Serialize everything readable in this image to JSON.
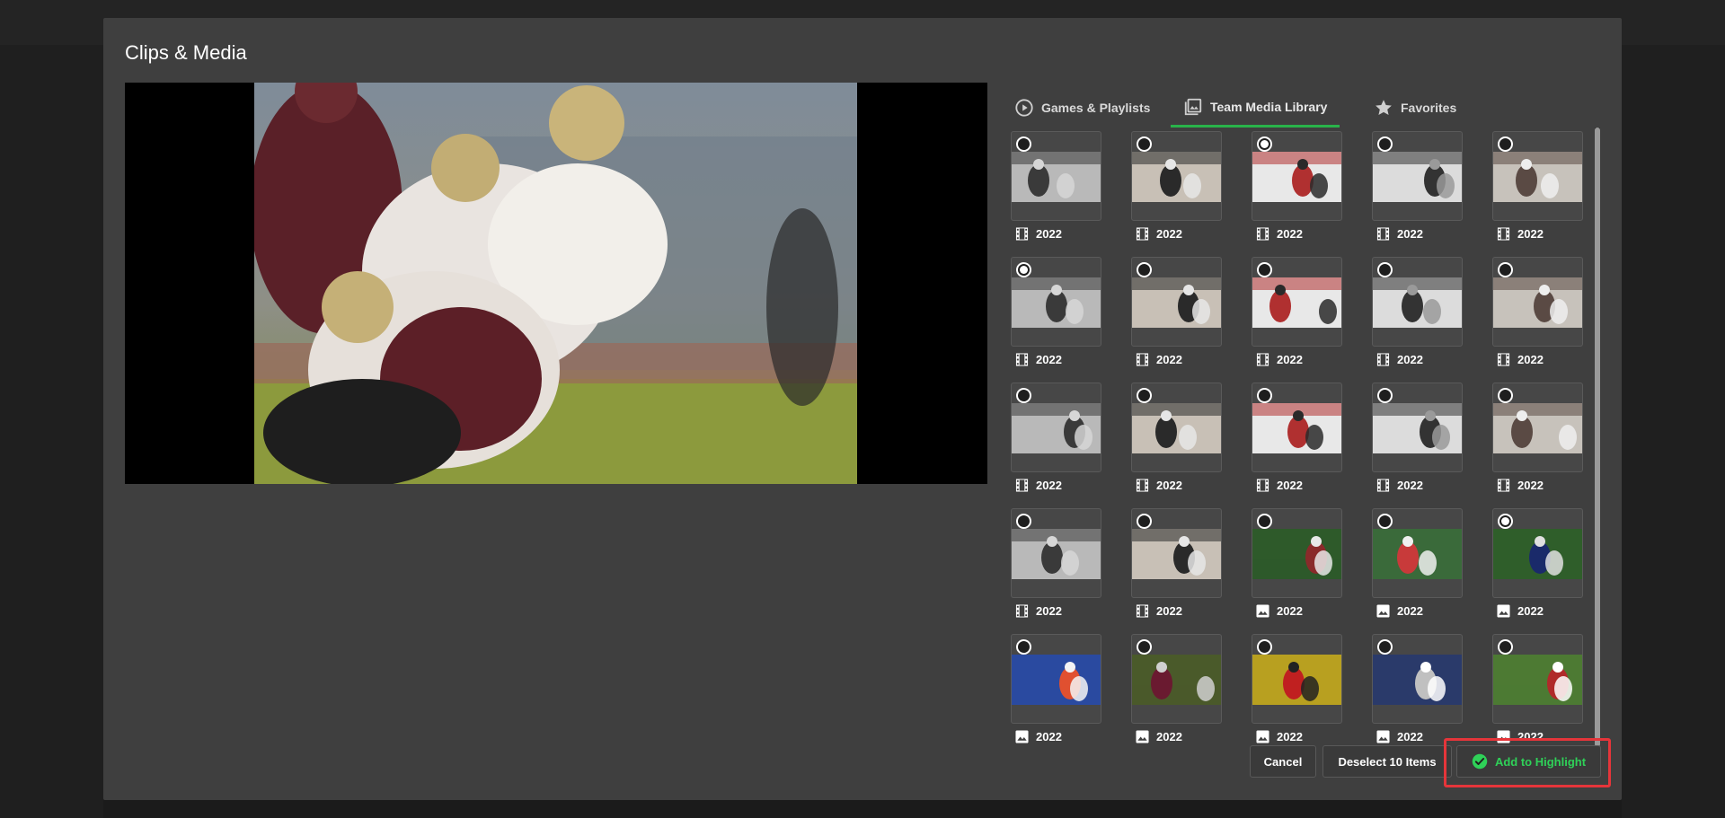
{
  "modal": {
    "title": "Clips & Media"
  },
  "tabs": [
    {
      "label": "Games & Playlists",
      "icon": "play-circle-icon",
      "active": false
    },
    {
      "label": "Team Media Library",
      "icon": "photo-library-icon",
      "active": true
    },
    {
      "label": "Favorites",
      "icon": "star-icon",
      "active": false
    }
  ],
  "media_items": [
    {
      "year": "2022",
      "type": "video",
      "selected": false
    },
    {
      "year": "2022",
      "type": "video",
      "selected": false
    },
    {
      "year": "2022",
      "type": "video",
      "selected": true
    },
    {
      "year": "2022",
      "type": "video",
      "selected": false
    },
    {
      "year": "2022",
      "type": "video",
      "selected": false
    },
    {
      "year": "2022",
      "type": "video",
      "selected": true
    },
    {
      "year": "2022",
      "type": "video",
      "selected": false
    },
    {
      "year": "2022",
      "type": "video",
      "selected": false
    },
    {
      "year": "2022",
      "type": "video",
      "selected": false
    },
    {
      "year": "2022",
      "type": "video",
      "selected": false
    },
    {
      "year": "2022",
      "type": "video",
      "selected": false
    },
    {
      "year": "2022",
      "type": "video",
      "selected": false
    },
    {
      "year": "2022",
      "type": "video",
      "selected": false
    },
    {
      "year": "2022",
      "type": "video",
      "selected": false
    },
    {
      "year": "2022",
      "type": "video",
      "selected": false
    },
    {
      "year": "2022",
      "type": "video",
      "selected": false
    },
    {
      "year": "2022",
      "type": "video",
      "selected": false
    },
    {
      "year": "2022",
      "type": "image",
      "selected": false
    },
    {
      "year": "2022",
      "type": "image",
      "selected": false
    },
    {
      "year": "2022",
      "type": "image",
      "selected": true
    },
    {
      "year": "2022",
      "type": "image",
      "selected": false
    },
    {
      "year": "2022",
      "type": "image",
      "selected": false
    },
    {
      "year": "2022",
      "type": "image",
      "selected": false
    },
    {
      "year": "2022",
      "type": "image",
      "selected": false
    },
    {
      "year": "2022",
      "type": "image",
      "selected": false
    }
  ],
  "footer": {
    "cancel_label": "Cancel",
    "deselect_label": "Deselect 10 Items",
    "add_label": "Add to Highlight"
  },
  "colors": {
    "accent_green": "#29b34a",
    "add_text_green": "#2fd158",
    "highlight_red": "#e5353a"
  }
}
